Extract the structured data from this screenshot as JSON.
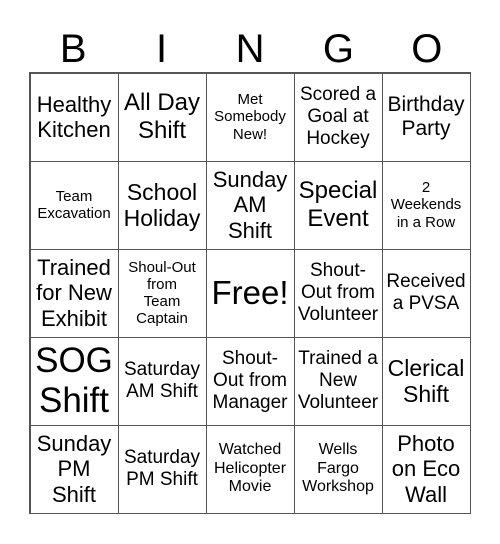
{
  "header": [
    "B",
    "I",
    "N",
    "G",
    "O"
  ],
  "cells": [
    "Healthy\nKitchen",
    "All Day\nShift",
    "Met\nSomebody\nNew!",
    "Scored a\nGoal at\nHockey",
    "Birthday\nParty",
    "Team\nExcavation",
    "School\nHoliday",
    "Sunday\nAM\nShift",
    "Special\nEvent",
    "2\nWeekends\nin a Row",
    "Trained\nfor New\nExhibit",
    "Shoul-Out\nfrom\nTeam\nCaptain",
    "Free!",
    "Shout-\nOut from\nVolunteer",
    "Received\na PVSA",
    "SOG\nShift",
    "Saturday\nAM Shift",
    "Shout-\nOut from\nManager",
    "Trained a\nNew\nVolunteer",
    "Clerical\nShift",
    "Sunday\nPM\nShift",
    "Saturday\nPM Shift",
    "Watched\nHelicopter\nMovie",
    "Wells\nFargo\nWorkshop",
    "Photo\non Eco\nWall"
  ]
}
